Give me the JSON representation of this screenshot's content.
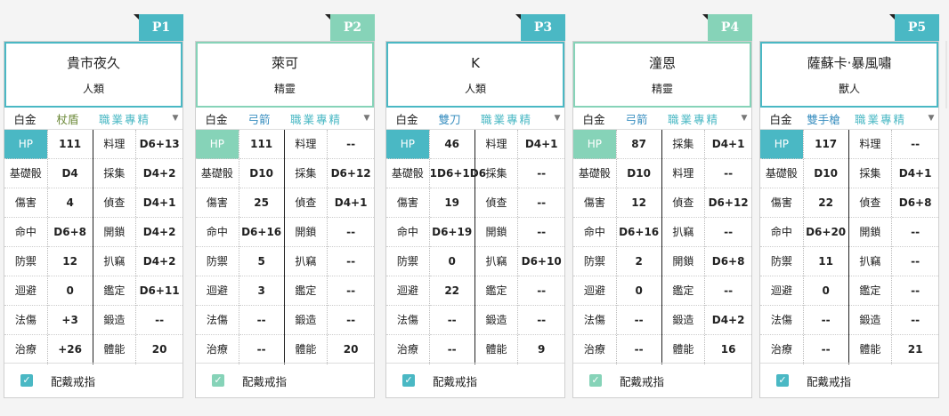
{
  "common": {
    "base_label": "白金",
    "prof_label": "職業專精",
    "ring_label": "配戴戒指",
    "stat_labels": [
      "HP",
      "基礎骰",
      "傷害",
      "命中",
      "防禦",
      "迴避",
      "法傷",
      "治療"
    ]
  },
  "colors": {
    "teal": "#4ab8c4",
    "mint": "#86d3b8",
    "staff_text": "#6d8a3a",
    "weapon_text": "#3a8fc0",
    "prof_text": "#4ab8c4"
  },
  "cards": [
    {
      "tab": "P1",
      "tab_color": "#4ab8c4",
      "accent": "#4ab8c4",
      "name": "貴市夜久",
      "race": "人類",
      "weapon": "杖盾",
      "weapon_color": "#6d8a3a",
      "stats": [
        "111",
        "D4",
        "4",
        "D6+8",
        "12",
        "0",
        "+3",
        "+26"
      ],
      "skill_labels": [
        "料理",
        "採集",
        "偵查",
        "開鎖",
        "扒竊",
        "鑑定",
        "鍛造",
        "體能"
      ],
      "skills": [
        "D6+13",
        "D4+2",
        "D4+1",
        "D4+2",
        "D4+2",
        "D6+11",
        "--",
        "20"
      ]
    },
    {
      "tab": "P2",
      "tab_color": "#86d3b8",
      "accent": "#86d3b8",
      "name": "萊可",
      "race": "精靈",
      "weapon": "弓箭",
      "weapon_color": "#3a8fc0",
      "stats": [
        "111",
        "D10",
        "25",
        "D6+16",
        "5",
        "3",
        "--",
        "--"
      ],
      "skill_labels": [
        "料理",
        "採集",
        "偵查",
        "開鎖",
        "扒竊",
        "鑑定",
        "鍛造",
        "體能"
      ],
      "skills": [
        "--",
        "D6+12",
        "D4+1",
        "--",
        "--",
        "--",
        "--",
        "20"
      ]
    },
    {
      "tab": "P3",
      "tab_color": "#4ab8c4",
      "accent": "#4ab8c4",
      "name": "K",
      "race": "人類",
      "weapon": "雙刀",
      "weapon_color": "#3a8fc0",
      "stats": [
        "46",
        "1D6+1D6",
        "19",
        "D6+19",
        "0",
        "22",
        "--",
        "--"
      ],
      "skill_labels": [
        "料理",
        "採集",
        "偵查",
        "開鎖",
        "扒竊",
        "鑑定",
        "鍛造",
        "體能"
      ],
      "skills": [
        "D4+1",
        "--",
        "--",
        "--",
        "D6+10",
        "--",
        "--",
        "9"
      ]
    },
    {
      "tab": "P4",
      "tab_color": "#86d3b8",
      "accent": "#86d3b8",
      "name": "潼恩",
      "race": "精靈",
      "weapon": "弓箭",
      "weapon_color": "#3a8fc0",
      "stats": [
        "87",
        "D10",
        "12",
        "D6+16",
        "2",
        "0",
        "--",
        "--"
      ],
      "skill_labels": [
        "採集",
        "料理",
        "偵查",
        "扒竊",
        "開鎖",
        "鑑定",
        "鍛造",
        "體能"
      ],
      "skills": [
        "D4+1",
        "--",
        "D6+12",
        "--",
        "D6+8",
        "--",
        "D4+2",
        "16"
      ]
    },
    {
      "tab": "P5",
      "tab_color": "#4ab8c4",
      "accent": "#4ab8c4",
      "name": "薩蘇卡·暴風嘯",
      "race": "獸人",
      "weapon": "雙手槍",
      "weapon_color": "#3a8fc0",
      "stats": [
        "117",
        "D10",
        "22",
        "D6+20",
        "11",
        "0",
        "--",
        "--"
      ],
      "skill_labels": [
        "料理",
        "採集",
        "偵查",
        "開鎖",
        "扒竊",
        "鑑定",
        "鍛造",
        "體能"
      ],
      "skills": [
        "--",
        "D4+1",
        "D6+8",
        "--",
        "--",
        "--",
        "--",
        "21"
      ]
    }
  ]
}
